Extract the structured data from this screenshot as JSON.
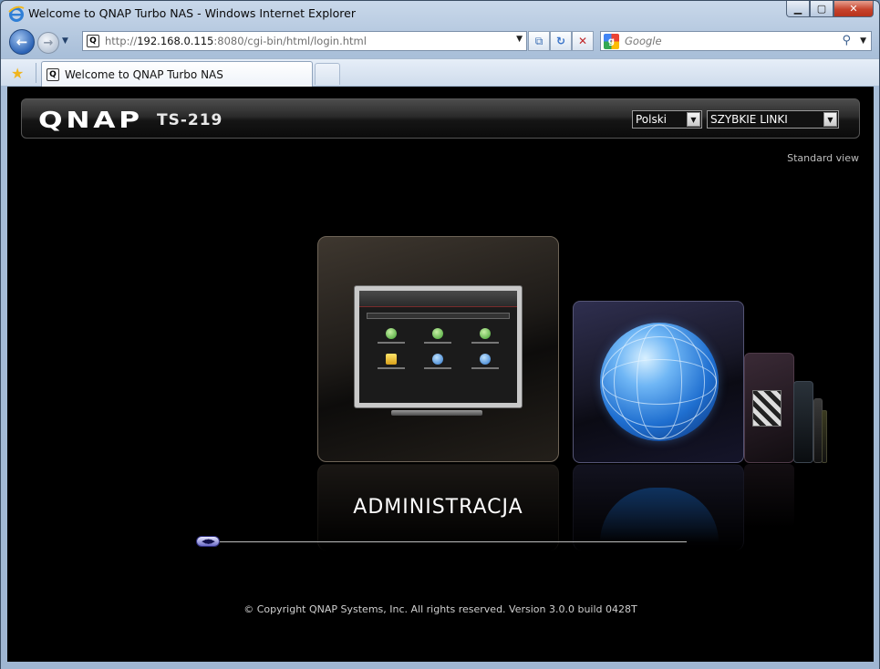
{
  "window": {
    "title": "Welcome to QNAP Turbo NAS - Windows Internet Explorer",
    "controls": {
      "minimize": "▁",
      "maximize": "▢",
      "close": "✕"
    }
  },
  "navigation": {
    "back_icon": "←",
    "forward_icon": "→",
    "history_dropdown": "▼",
    "address": {
      "prefix": "http://",
      "host": "192.168.0.115",
      "rest": ":8080/cgi-bin/html/login.html",
      "dropdown": "▼"
    },
    "compat_icon": "⧉",
    "refresh_icon": "↻",
    "stop_icon": "✕",
    "search": {
      "placeholder": "Google",
      "icon": "⚲",
      "dropdown": "▼",
      "engine_letter": "g"
    }
  },
  "tabs": {
    "favorites_icon": "★",
    "items": [
      {
        "label": "Welcome to QNAP Turbo NAS",
        "favicon": "Q"
      }
    ]
  },
  "page": {
    "logo": "QNAP",
    "model": "TS-219",
    "language_select": {
      "selected": "Polski"
    },
    "quick_links_select": {
      "selected": "SZYBKIE LINKI"
    },
    "standard_view": "Standard view",
    "carousel": {
      "active_caption": "ADMINISTRACJA",
      "items": [
        {
          "id": "administration",
          "icon": "monitor-icon"
        },
        {
          "id": "web",
          "icon": "globe-icon"
        },
        {
          "id": "multimedia",
          "icon": "clapperboard-icon"
        }
      ]
    },
    "copyright": "© Copyright QNAP Systems, Inc. All rights reserved. Version 3.0.0 build 0428T"
  }
}
